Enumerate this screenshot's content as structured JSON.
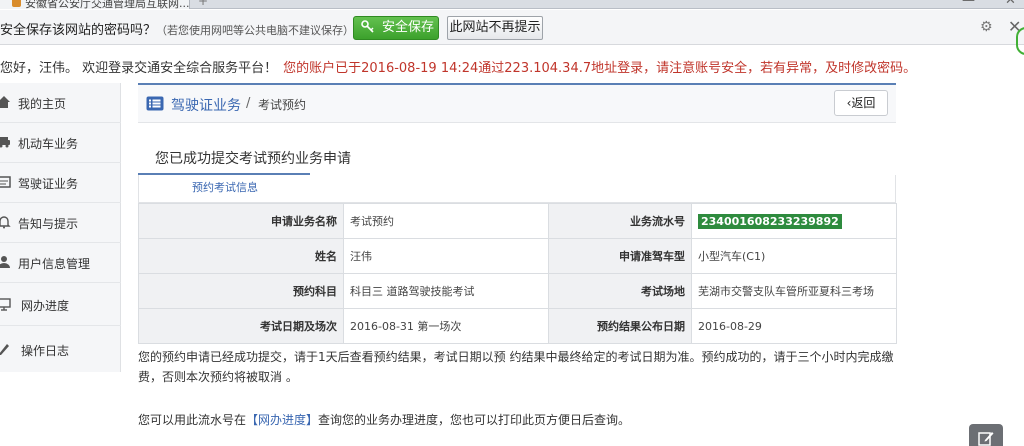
{
  "browser": {
    "tab_title": "安徽省公安厅交通管理局互联网..."
  },
  "password_bar": {
    "question": "安全保存该网站的密码吗？",
    "note": "（若您使用网吧等公共电脑不建议保存）",
    "save_button": "安全保存",
    "never_button": "此网站不再提示"
  },
  "welcome": {
    "greeting": "您好，汪伟。  欢迎登录交通安全综合服务平台！",
    "warning": "您的账户已于2016-08-19 14:24通过223.104.34.7地址登录，请注意账号安全，若有异常，及时修改密码。"
  },
  "sidebar": {
    "items": [
      {
        "label": "我的主页",
        "icon": "home-icon"
      },
      {
        "label": "机动车业务",
        "icon": "car-icon"
      },
      {
        "label": "驾驶证业务",
        "icon": "license-icon"
      },
      {
        "label": "告知与提示",
        "icon": "bell-icon"
      },
      {
        "label": "用户信息管理",
        "icon": "user-icon"
      },
      {
        "label": "网办进度",
        "icon": "monitor-icon"
      },
      {
        "label": "操作日志",
        "icon": "log-icon"
      }
    ]
  },
  "main": {
    "breadcrumb_main": "驾驶证业务",
    "breadcrumb_sep": "/",
    "breadcrumb_sub": "考试预约",
    "back_button": "返回",
    "success_title": "您已成功提交考试预约业务申请",
    "tab_label": "预约考试信息",
    "table": {
      "rows": [
        {
          "l1": "申请业务名称",
          "v1": "考试预约",
          "l2": "业务流水号",
          "v2": "234001608233239892"
        },
        {
          "l1": "姓名",
          "v1": "汪伟",
          "l2": "申请准驾车型",
          "v2": "小型汽车(C1)"
        },
        {
          "l1": "预约科目",
          "v1": "科目三 道路驾驶技能考试",
          "l2": "考试场地",
          "v2": "芜湖市交警支队车管所亚夏科三考场"
        },
        {
          "l1": "考试日期及场次",
          "v1": "2016-08-31 第一场次",
          "l2": "预约结果公布日期",
          "v2": "2016-08-29"
        }
      ]
    },
    "notice": "您的预约申请已经成功提交，请于1天后查看预约结果，考试日期以预 约结果中最终给定的考试日期为准。预约成功的，请于三个小时内完成缴费，否则本次预约将被取消 。",
    "notice2_pre": "您可以用此流水号在",
    "notice2_link": "【网办进度】",
    "notice2_post": "查询您的业务办理进度，您也可以打印此页方便日后查询。"
  },
  "colors": {
    "accent": "#3a67b1",
    "warning": "#c0352b",
    "save_green": "#3ca12c",
    "serial_green": "#2e8b3e"
  }
}
